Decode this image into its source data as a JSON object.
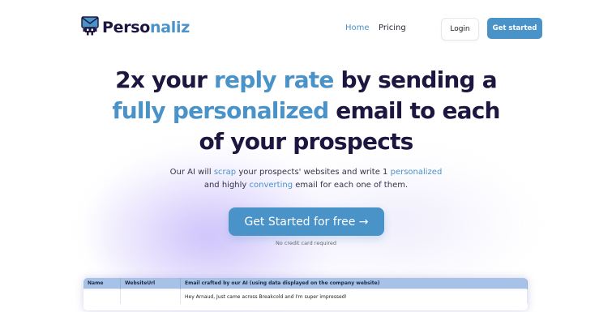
{
  "brand": {
    "name_part1": "Perso",
    "name_part2": "naliz"
  },
  "nav": {
    "home": "Home",
    "pricing": "Pricing",
    "login": "Login",
    "get_started": "Get started"
  },
  "hero": {
    "line1_a": "2x your ",
    "line1_hl": "reply rate",
    "line1_b": " by sending a",
    "line2_hl": "fully personalized",
    "line2_b": " email to each",
    "line3": "of your prospects",
    "sub1_a": "Our AI will ",
    "sub1_hl1": "scrap",
    "sub1_b": " your prospects' websites and write 1 ",
    "sub1_hl2": "personalized",
    "sub2_a": "and highly ",
    "sub2_hl": "converting",
    "sub2_b": " email for each one of them.",
    "cta": "Get Started for free →",
    "no_card": "No credit card required"
  },
  "table": {
    "headers": [
      "Name",
      "WebsiteUrl",
      "Email crafted by our AI (using data displayed on the company website)"
    ],
    "rows": [
      [
        "",
        "",
        "Hey Arnaud, Just came across Breakcold and I'm super impressed!"
      ]
    ]
  },
  "colors": {
    "accent": "#4a93c9",
    "dark": "#1c1640",
    "table_header": "#a7c2e6"
  },
  "icons": {
    "logo": "robot-envelope-icon"
  }
}
